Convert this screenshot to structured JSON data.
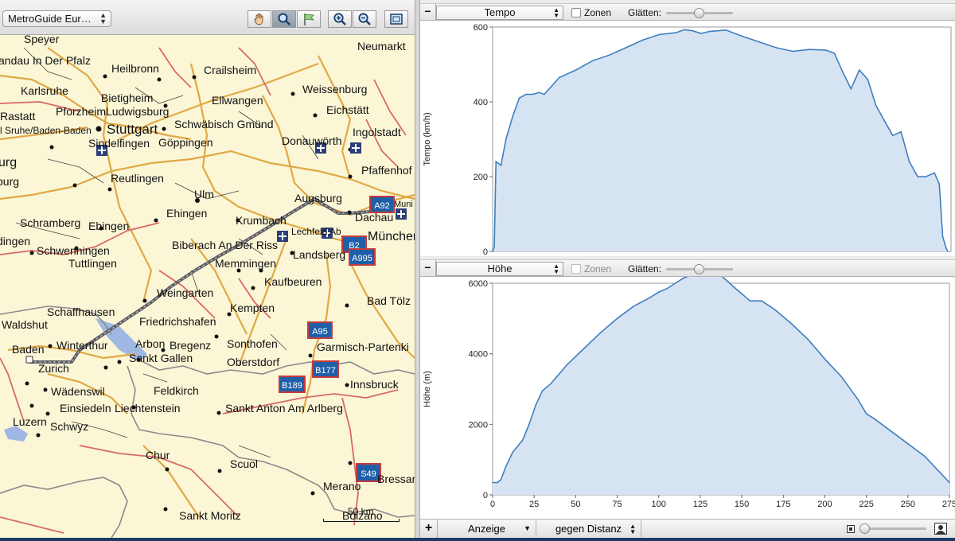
{
  "map": {
    "map_selector": "MetroGuide Eur…",
    "tools": [
      "pan-tool",
      "zoom-select-tool",
      "flag-tool",
      "zoom-in",
      "zoom-out",
      "fit-view"
    ],
    "scale_label": "50 km",
    "places": [
      "Speyer",
      "Neumarkt",
      "andau In Der Pfalz",
      "Heilbronn",
      "Crailsheim",
      "Karlsruhe",
      "Weissenburg",
      "Bietigheim",
      "PforzheimLudwigsburg",
      "Ellwangen",
      "Eichstätt",
      "Rastatt",
      "rl Sruhe/Baden-Baden",
      "Stuttgart",
      "Schwäbisch Gmünd",
      "Ingolstadt",
      "Donauwörth",
      "Sindelfingen",
      "Göppingen",
      "urg",
      "Pfaffenhof",
      "burg",
      "Reutlingen",
      "Ulm",
      "Augsburg",
      "Muni",
      "Ehingen",
      "Dachau",
      "Schramberg",
      "Ebingen",
      "Krumbach",
      "Lechfeld Ab",
      "München",
      "dingen",
      "Biberach An Der Riss",
      "Schwenningen",
      "Landsberg",
      "Tuttlingen",
      "Memmingen",
      "Kaufbeuren",
      "Weingarten",
      "Schaffhausen",
      "Kempten",
      "Bad Tölz",
      "Waldshut",
      "Friedrichshafen",
      "Arbon",
      "Bregenz",
      "Sonthofen",
      "Garmisch-Partenki",
      "Winterthur",
      "Baden",
      "Sankt Gallen",
      "Oberstdorf",
      "Zurich",
      "Wädenswil",
      "Feldkirch",
      "Innsbruck",
      "Einsiedeln",
      "Liechtenstein",
      "Sankt Anton Am Arlberg",
      "Luzern",
      "Schwyz",
      "Chur",
      "Scuol",
      "Bressar",
      "Merano",
      "Sankt Moritz",
      "Bolzano"
    ],
    "road_shields": [
      "A92",
      "B2",
      "A995",
      "A95",
      "B177",
      "B189",
      "S49"
    ]
  },
  "speed_panel": {
    "metric": "Tempo",
    "zones_label": "Zonen",
    "smooth_label": "Glätten:",
    "smooth_level": 0.5
  },
  "elevation_panel": {
    "metric": "Höhe",
    "zones_label": "Zonen",
    "smooth_label": "Glätten:",
    "smooth_level": 0.5
  },
  "bottom_bar": {
    "add_label": "+",
    "display_label": "Anzeige",
    "axis_mode": "gegen Distanz"
  },
  "chart_data": [
    {
      "type": "area",
      "ylabel": "Tempo (km/h)",
      "ylim": [
        0,
        600
      ],
      "yticks": [
        "0",
        "200",
        "400",
        "600"
      ],
      "xlim": [
        0,
        275
      ],
      "x": [
        0,
        1,
        2,
        5,
        8,
        12,
        16,
        20,
        24,
        28,
        31,
        35,
        40,
        50,
        60,
        70,
        80,
        90,
        100,
        110,
        115,
        120,
        125,
        130,
        140,
        150,
        160,
        170,
        180,
        190,
        200,
        205,
        210,
        215,
        220,
        225,
        230,
        235,
        240,
        245,
        250,
        255,
        260,
        265,
        268,
        270,
        272,
        273
      ],
      "values": [
        0,
        12,
        240,
        230,
        300,
        360,
        410,
        420,
        420,
        425,
        420,
        440,
        465,
        485,
        510,
        525,
        545,
        565,
        580,
        585,
        593,
        590,
        583,
        588,
        592,
        575,
        560,
        545,
        535,
        540,
        538,
        530,
        480,
        435,
        485,
        460,
        390,
        350,
        310,
        320,
        240,
        200,
        200,
        210,
        180,
        40,
        10,
        0
      ]
    },
    {
      "type": "area",
      "ylabel": "Höhe (m)",
      "ylim": [
        0,
        6000
      ],
      "yticks": [
        "0",
        "2000",
        "4000",
        "6000"
      ],
      "xlim": [
        0,
        275
      ],
      "xticks": [
        "0",
        "25",
        "50",
        "75",
        "100",
        "125",
        "150",
        "175",
        "200",
        "225",
        "250",
        "275"
      ],
      "x": [
        0,
        3,
        5,
        8,
        12,
        18,
        22,
        26,
        30,
        35,
        45,
        55,
        65,
        75,
        85,
        95,
        100,
        105,
        110,
        115,
        118,
        125,
        130,
        135,
        138,
        145,
        155,
        162,
        170,
        180,
        190,
        200,
        210,
        220,
        225,
        230,
        240,
        250,
        260,
        270,
        275
      ],
      "values": [
        350,
        350,
        430,
        800,
        1200,
        1550,
        2000,
        2550,
        2950,
        3150,
        3700,
        4150,
        4600,
        5000,
        5350,
        5600,
        5750,
        5850,
        6000,
        6150,
        6200,
        6200,
        6200,
        6200,
        6200,
        5900,
        5500,
        5500,
        5250,
        4850,
        4400,
        3850,
        3350,
        2700,
        2300,
        2150,
        1800,
        1450,
        1100,
        600,
        350
      ]
    }
  ]
}
